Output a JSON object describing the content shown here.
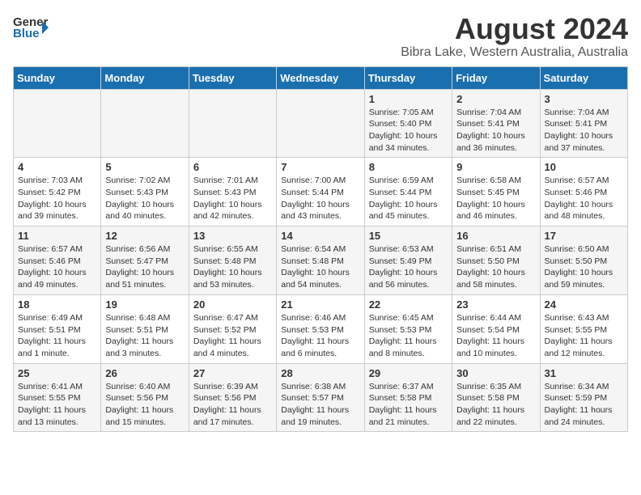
{
  "header": {
    "logo_line1": "General",
    "logo_line2": "Blue",
    "title": "August 2024",
    "subtitle": "Bibra Lake, Western Australia, Australia"
  },
  "days_of_week": [
    "Sunday",
    "Monday",
    "Tuesday",
    "Wednesday",
    "Thursday",
    "Friday",
    "Saturday"
  ],
  "weeks": [
    [
      {
        "day": "",
        "info": ""
      },
      {
        "day": "",
        "info": ""
      },
      {
        "day": "",
        "info": ""
      },
      {
        "day": "",
        "info": ""
      },
      {
        "day": "1",
        "info": "Sunrise: 7:05 AM\nSunset: 5:40 PM\nDaylight: 10 hours\nand 34 minutes."
      },
      {
        "day": "2",
        "info": "Sunrise: 7:04 AM\nSunset: 5:41 PM\nDaylight: 10 hours\nand 36 minutes."
      },
      {
        "day": "3",
        "info": "Sunrise: 7:04 AM\nSunset: 5:41 PM\nDaylight: 10 hours\nand 37 minutes."
      }
    ],
    [
      {
        "day": "4",
        "info": "Sunrise: 7:03 AM\nSunset: 5:42 PM\nDaylight: 10 hours\nand 39 minutes."
      },
      {
        "day": "5",
        "info": "Sunrise: 7:02 AM\nSunset: 5:43 PM\nDaylight: 10 hours\nand 40 minutes."
      },
      {
        "day": "6",
        "info": "Sunrise: 7:01 AM\nSunset: 5:43 PM\nDaylight: 10 hours\nand 42 minutes."
      },
      {
        "day": "7",
        "info": "Sunrise: 7:00 AM\nSunset: 5:44 PM\nDaylight: 10 hours\nand 43 minutes."
      },
      {
        "day": "8",
        "info": "Sunrise: 6:59 AM\nSunset: 5:44 PM\nDaylight: 10 hours\nand 45 minutes."
      },
      {
        "day": "9",
        "info": "Sunrise: 6:58 AM\nSunset: 5:45 PM\nDaylight: 10 hours\nand 46 minutes."
      },
      {
        "day": "10",
        "info": "Sunrise: 6:57 AM\nSunset: 5:46 PM\nDaylight: 10 hours\nand 48 minutes."
      }
    ],
    [
      {
        "day": "11",
        "info": "Sunrise: 6:57 AM\nSunset: 5:46 PM\nDaylight: 10 hours\nand 49 minutes."
      },
      {
        "day": "12",
        "info": "Sunrise: 6:56 AM\nSunset: 5:47 PM\nDaylight: 10 hours\nand 51 minutes."
      },
      {
        "day": "13",
        "info": "Sunrise: 6:55 AM\nSunset: 5:48 PM\nDaylight: 10 hours\nand 53 minutes."
      },
      {
        "day": "14",
        "info": "Sunrise: 6:54 AM\nSunset: 5:48 PM\nDaylight: 10 hours\nand 54 minutes."
      },
      {
        "day": "15",
        "info": "Sunrise: 6:53 AM\nSunset: 5:49 PM\nDaylight: 10 hours\nand 56 minutes."
      },
      {
        "day": "16",
        "info": "Sunrise: 6:51 AM\nSunset: 5:50 PM\nDaylight: 10 hours\nand 58 minutes."
      },
      {
        "day": "17",
        "info": "Sunrise: 6:50 AM\nSunset: 5:50 PM\nDaylight: 10 hours\nand 59 minutes."
      }
    ],
    [
      {
        "day": "18",
        "info": "Sunrise: 6:49 AM\nSunset: 5:51 PM\nDaylight: 11 hours\nand 1 minute."
      },
      {
        "day": "19",
        "info": "Sunrise: 6:48 AM\nSunset: 5:51 PM\nDaylight: 11 hours\nand 3 minutes."
      },
      {
        "day": "20",
        "info": "Sunrise: 6:47 AM\nSunset: 5:52 PM\nDaylight: 11 hours\nand 4 minutes."
      },
      {
        "day": "21",
        "info": "Sunrise: 6:46 AM\nSunset: 5:53 PM\nDaylight: 11 hours\nand 6 minutes."
      },
      {
        "day": "22",
        "info": "Sunrise: 6:45 AM\nSunset: 5:53 PM\nDaylight: 11 hours\nand 8 minutes."
      },
      {
        "day": "23",
        "info": "Sunrise: 6:44 AM\nSunset: 5:54 PM\nDaylight: 11 hours\nand 10 minutes."
      },
      {
        "day": "24",
        "info": "Sunrise: 6:43 AM\nSunset: 5:55 PM\nDaylight: 11 hours\nand 12 minutes."
      }
    ],
    [
      {
        "day": "25",
        "info": "Sunrise: 6:41 AM\nSunset: 5:55 PM\nDaylight: 11 hours\nand 13 minutes."
      },
      {
        "day": "26",
        "info": "Sunrise: 6:40 AM\nSunset: 5:56 PM\nDaylight: 11 hours\nand 15 minutes."
      },
      {
        "day": "27",
        "info": "Sunrise: 6:39 AM\nSunset: 5:56 PM\nDaylight: 11 hours\nand 17 minutes."
      },
      {
        "day": "28",
        "info": "Sunrise: 6:38 AM\nSunset: 5:57 PM\nDaylight: 11 hours\nand 19 minutes."
      },
      {
        "day": "29",
        "info": "Sunrise: 6:37 AM\nSunset: 5:58 PM\nDaylight: 11 hours\nand 21 minutes."
      },
      {
        "day": "30",
        "info": "Sunrise: 6:35 AM\nSunset: 5:58 PM\nDaylight: 11 hours\nand 22 minutes."
      },
      {
        "day": "31",
        "info": "Sunrise: 6:34 AM\nSunset: 5:59 PM\nDaylight: 11 hours\nand 24 minutes."
      }
    ]
  ]
}
